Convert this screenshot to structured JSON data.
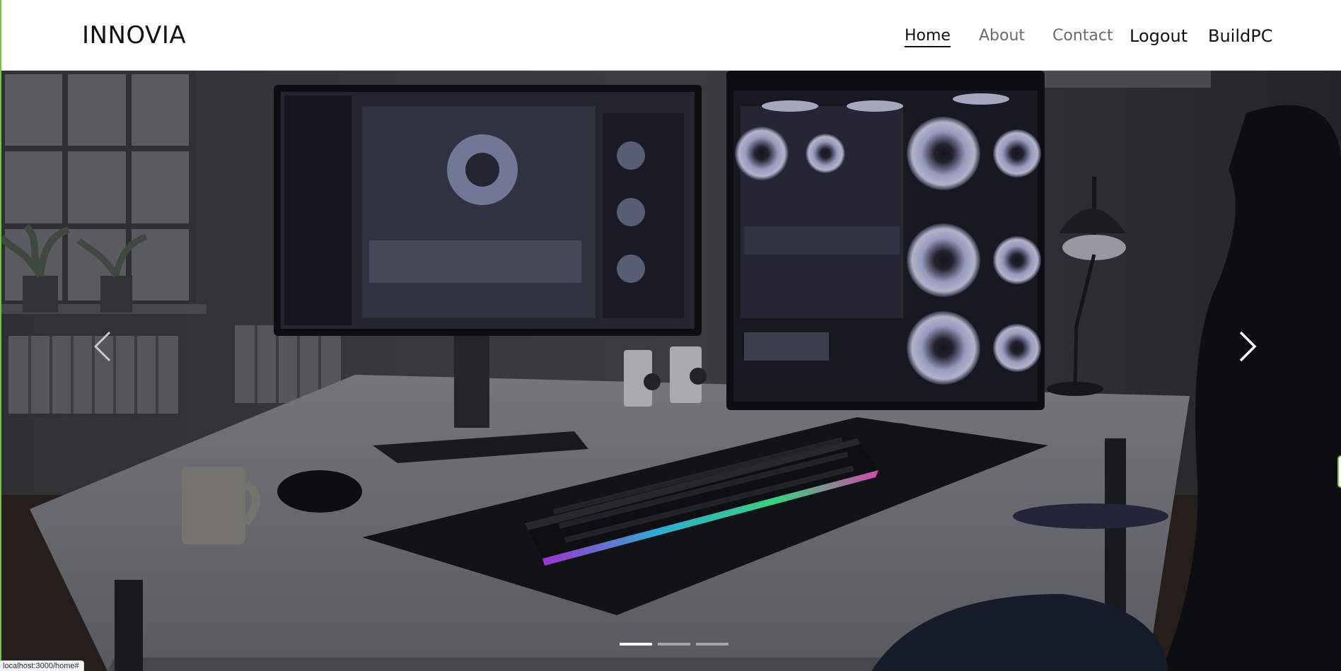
{
  "brand": "INNOVIA",
  "nav": {
    "home": "Home",
    "about": "About",
    "contact": "Contact",
    "logout": "Logout",
    "buildpc": "BuildPC"
  },
  "carousel": {
    "active_slide": 1,
    "slide_count": 3,
    "prev_icon": "chevron-left-icon",
    "next_icon": "chevron-right-icon"
  },
  "status_bar": {
    "url": "localhost:3000/home#"
  },
  "colors": {
    "accent": "#7cc242",
    "nav_active": "#111111",
    "nav_inactive": "#6b6b6b"
  }
}
